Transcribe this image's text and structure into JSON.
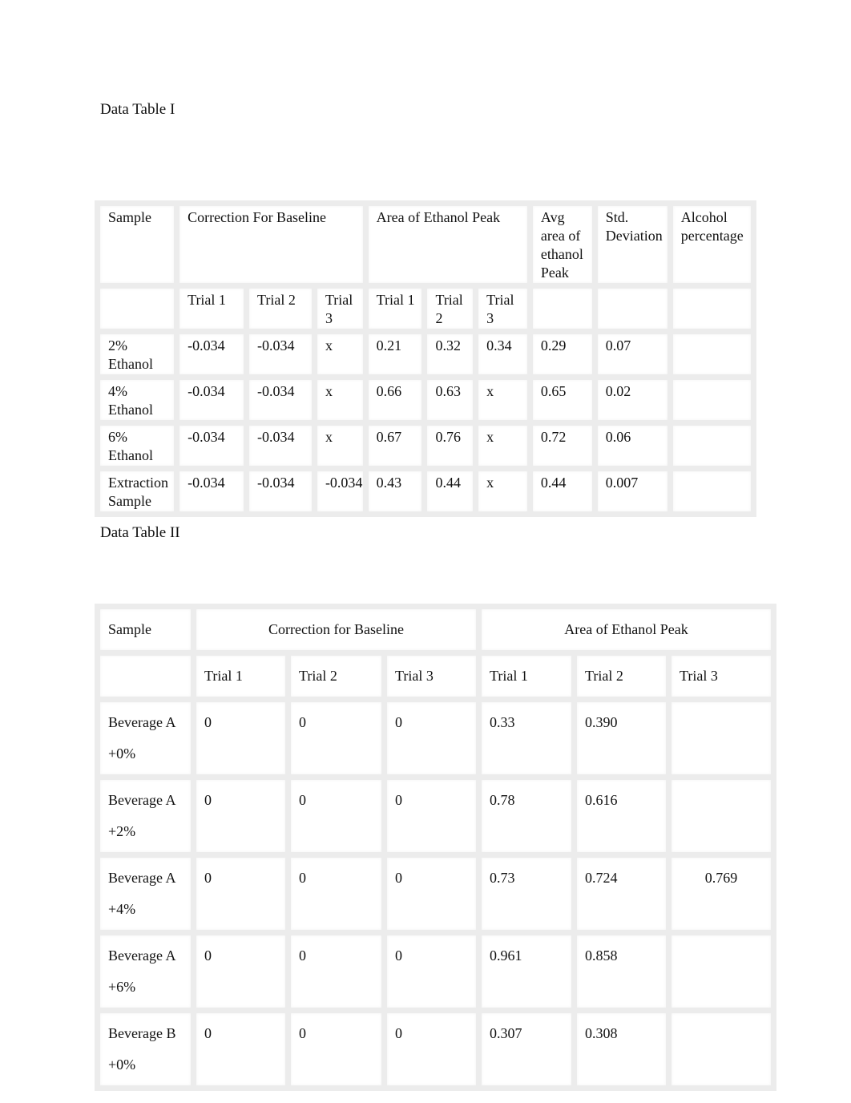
{
  "table1": {
    "title": "Data Table I",
    "headers": {
      "sample": "Sample",
      "correction": "Correction For Baseline",
      "area": "Area of Ethanol Peak",
      "avg": "Avg area of ethanol Peak",
      "std": "Std. Deviation",
      "alcohol": "Alcohol percentage"
    },
    "subheaders": [
      "Trial 1",
      "Trial 2",
      "Trial 3",
      "Trial 1",
      "Trial 2",
      "Trial 3"
    ],
    "rows": [
      {
        "sample": "2% Ethanol",
        "c1": "-0.034",
        "c2": "-0.034",
        "c3": "x",
        "a1": "0.21",
        "a2": "0.32",
        "a3": "0.34",
        "avg": "0.29",
        "std": "0.07",
        "alcohol": ""
      },
      {
        "sample": "4% Ethanol",
        "c1": "-0.034",
        "c2": "-0.034",
        "c3": "x",
        "a1": "0.66",
        "a2": "0.63",
        "a3": "x",
        "avg": "0.65",
        "std": "0.02",
        "alcohol": ""
      },
      {
        "sample": "6% Ethanol",
        "c1": "-0.034",
        "c2": "-0.034",
        "c3": "x",
        "a1": "0.67",
        "a2": "0.76",
        "a3": "x",
        "avg": "0.72",
        "std": "0.06",
        "alcohol": ""
      },
      {
        "sample": "Extraction Sample",
        "c1": "-0.034",
        "c2": "-0.034",
        "c3": "-0.034",
        "a1": "0.43",
        "a2": "0.44",
        "a3": "x",
        "avg": "0.44",
        "std": "0.007",
        "alcohol": ""
      }
    ]
  },
  "table2": {
    "title": "Data Table II",
    "headers": {
      "sample": "Sample",
      "correction": "Correction for Baseline",
      "area": "Area of Ethanol Peak"
    },
    "subheaders": [
      "Trial 1",
      "Trial 2",
      "Trial 3",
      "Trial 1",
      "Trial 2",
      "Trial 3"
    ],
    "rows": [
      {
        "sample": "Beverage A +0%",
        "c1": "0",
        "c2": "0",
        "c3": "0",
        "a1": "0.33",
        "a2": "0.390",
        "a3": ""
      },
      {
        "sample": "Beverage A +2%",
        "c1": "0",
        "c2": "0",
        "c3": "0",
        "a1": "0.78",
        "a2": "0.616",
        "a3": ""
      },
      {
        "sample": "Beverage A +4%",
        "c1": "0",
        "c2": "0",
        "c3": "0",
        "a1": "0.73",
        "a2": "0.724",
        "a3": "0.769"
      },
      {
        "sample": "Beverage A +6%",
        "c1": "0",
        "c2": "0",
        "c3": "0",
        "a1": "0.961",
        "a2": "0.858",
        "a3": ""
      },
      {
        "sample": "Beverage B +0%",
        "c1": "0",
        "c2": "0",
        "c3": "0",
        "a1": "0.307",
        "a2": "0.308",
        "a3": ""
      }
    ]
  }
}
